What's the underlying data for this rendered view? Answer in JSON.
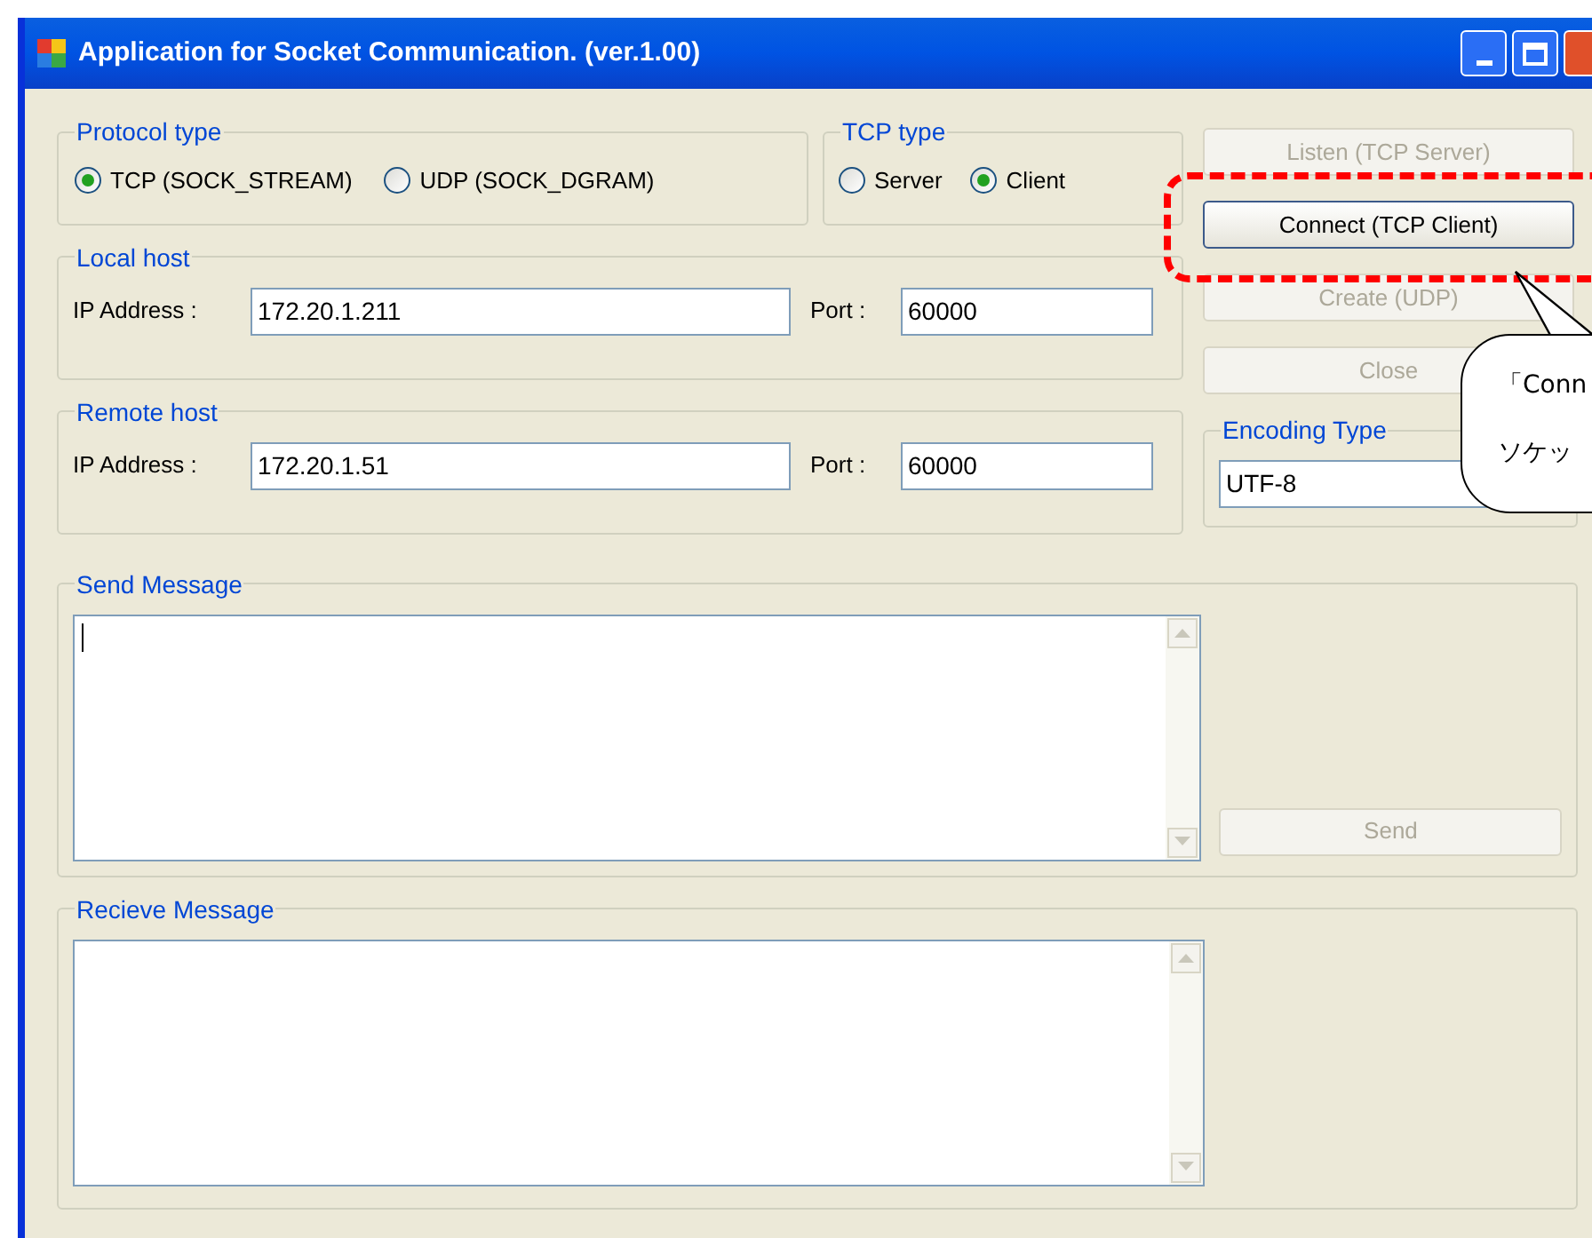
{
  "window": {
    "title": "Application for Socket Communication. (ver.1.00)"
  },
  "protocol_type": {
    "label": "Protocol type",
    "options": [
      {
        "label": "TCP (SOCK_STREAM)",
        "selected": true
      },
      {
        "label": "UDP (SOCK_DGRAM)",
        "selected": false
      }
    ]
  },
  "tcp_type": {
    "label": "TCP type",
    "options": [
      {
        "label": "Server",
        "selected": false
      },
      {
        "label": "Client",
        "selected": true
      }
    ]
  },
  "local_host": {
    "label": "Local host",
    "ip_label": "IP Address :",
    "ip": "172.20.1.211",
    "port_label": "Port :",
    "port": "60000"
  },
  "remote_host": {
    "label": "Remote host",
    "ip_label": "IP Address :",
    "ip": "172.20.1.51",
    "port_label": "Port :",
    "port": "60000"
  },
  "buttons": [
    {
      "label": "Listen (TCP Server)",
      "disabled": true
    },
    {
      "label": "Connect (TCP Client)",
      "disabled": false
    },
    {
      "label": "Create (UDP)",
      "disabled": true
    },
    {
      "label": "Close",
      "disabled": true
    }
  ],
  "encoding": {
    "label": "Encoding Type",
    "value": "UTF-8"
  },
  "send_message": {
    "label": "Send Message",
    "button": {
      "label": "Send",
      "disabled": true
    }
  },
  "receive_message": {
    "label": "Recieve Message"
  },
  "callout": {
    "lines": [
      "「Conn",
      "ソケッ"
    ]
  }
}
